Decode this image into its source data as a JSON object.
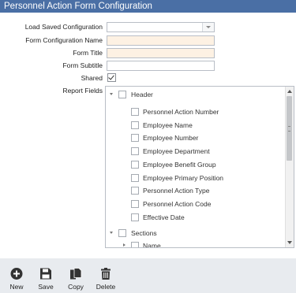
{
  "window": {
    "title": "Personnel Action Form Configuration"
  },
  "form": {
    "load_saved_label": "Load Saved Configuration",
    "load_saved_value": "",
    "config_name_label": "Form Configuration Name",
    "config_name_value": "",
    "form_title_label": "Form Title",
    "form_title_value": "",
    "form_subtitle_label": "Form Subtitle",
    "form_subtitle_value": "",
    "shared_label": "Shared",
    "shared_checked": true,
    "report_fields_label": "Report Fields"
  },
  "tree": {
    "header_group": "Header",
    "header_items": [
      "Personnel Action Number",
      "Employee Name",
      "Employee Number",
      "Employee Department",
      "Employee Benefit Group",
      "Employee Primary Position",
      "Personnel Action Type",
      "Personnel Action Code",
      "Effective Date"
    ],
    "sections_group": "Sections",
    "sections_items": [
      "Name"
    ]
  },
  "toolbar": {
    "new_label": "New",
    "save_label": "Save",
    "copy_label": "Copy",
    "delete_label": "Delete"
  },
  "colors": {
    "titlebar": "#4a6fa5",
    "required_field": "#fdf1e3",
    "toolbar_bg": "#e8ebef"
  },
  "icons": {
    "new": "plus-circle-icon",
    "save": "floppy-disk-icon",
    "copy": "copy-documents-icon",
    "delete": "trash-can-icon"
  }
}
